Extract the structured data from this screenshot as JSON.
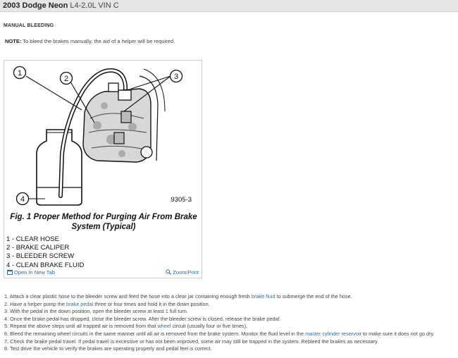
{
  "header": {
    "model": "2003 Dodge Neon",
    "engine": "L4-2.0L VIN C"
  },
  "section_title": "MANUAL BLEEDING",
  "note": {
    "label": "NOTE:",
    "text": " To bleed the brakes manually, the aid of a helper will be required."
  },
  "figure": {
    "callouts": [
      "1",
      "2",
      "3",
      "4"
    ],
    "ref_number": "9305-3",
    "caption": [
      "Fig. 1 Proper Method for Purging Air From Brake",
      "System (Typical)"
    ],
    "legend": [
      "1 - CLEAR HOSE",
      "2 - BRAKE CALIPER",
      "3 - BLEEDER SCREW",
      "4 - CLEAN BRAKE FLUID"
    ],
    "open_label": "Open In New Tab",
    "zoom_label": "Zoom/Print"
  },
  "steps": [
    {
      "pre": "1. Attach a clear plastic hose to the bleeder screw and feed the hose into a clear jar containing enough fresh ",
      "link": "brake fluid",
      "post": " to submerge the end of the hose."
    },
    {
      "pre": "2. Have a helper pump the ",
      "link": "brake pedal",
      "post": " three or four times and hold it in the down position."
    },
    {
      "pre": "3. With the pedal in the down position, open the bleeder screw at least 1 full turn.",
      "link": "",
      "post": ""
    },
    {
      "pre": "4. Once the brake pedal has dropped, close the bleeder screw. After the bleeder screw is closed, release the brake pedal.",
      "link": "",
      "post": ""
    },
    {
      "pre": "5. Repeat the above steps until all trapped air is removed from that ",
      "link": "wheel",
      "post": " circuit (usually four or five times)."
    },
    {
      "pre": "6. Bleed the remaining wheel circuits in the same manner until all air is removed from the brake system. Monitor the fluid level in the ",
      "link": "master cylinder reservoir",
      "post": " to make sure it does not go dry."
    },
    {
      "pre": "7. Check the brake pedal travel. If pedal travel is excessive or has not been improved, some air may still be trapped in the system. Rebleed the brakes as necessary.",
      "link": "",
      "post": ""
    },
    {
      "pre": "8. Test drive the vehicle to verify the brakes are operating properly and pedal feel is correct.",
      "link": "",
      "post": ""
    }
  ],
  "colors": {
    "link": "#2b6cb0",
    "header_bg": "#e6e6e6"
  }
}
